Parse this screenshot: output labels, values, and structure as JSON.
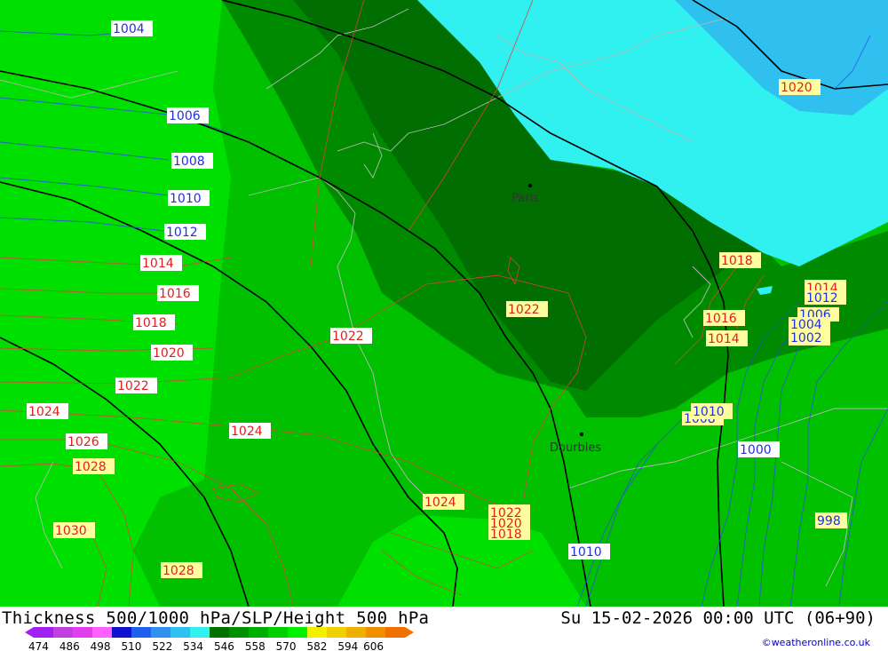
{
  "title": "Thickness 500/1000 hPa/SLP/Height 500 hPa",
  "datetime": "Su 15-02-2026 00:00 UTC (06+90)",
  "credit": "©weatheronline.co.uk",
  "legend": {
    "ticks": [
      "474",
      "486",
      "498",
      "510",
      "522",
      "534",
      "546",
      "558",
      "570",
      "582",
      "594",
      "606"
    ],
    "colors": [
      "#a020f0",
      "#c040e0",
      "#e040f0",
      "#ff60ff",
      "#1010d0",
      "#2060f0",
      "#3090f0",
      "#30c0f0",
      "#30f0f0",
      "#007000",
      "#009000",
      "#00b000",
      "#00d000",
      "#00f000",
      "#f0f000",
      "#f0d000",
      "#f0b000",
      "#f09000",
      "#f07000"
    ]
  },
  "cities": [
    {
      "name": "Paris"
    },
    {
      "name": "Dourbies"
    }
  ],
  "slp_labels_red": [
    "1014",
    "1016",
    "1018",
    "1020",
    "1022",
    "1024",
    "1022",
    "1024",
    "1026",
    "1028",
    "1030",
    "1028",
    "1024",
    "1022",
    "1022",
    "1020",
    "1018",
    "1018",
    "1016",
    "1014",
    "1018",
    "1016"
  ],
  "slp_labels_blue": [
    "1004",
    "1006",
    "1008",
    "1010",
    "1012",
    "1012",
    "1006",
    "1004",
    "1002",
    "1010",
    "1008",
    "1000",
    "998",
    "1010",
    "1020"
  ]
}
